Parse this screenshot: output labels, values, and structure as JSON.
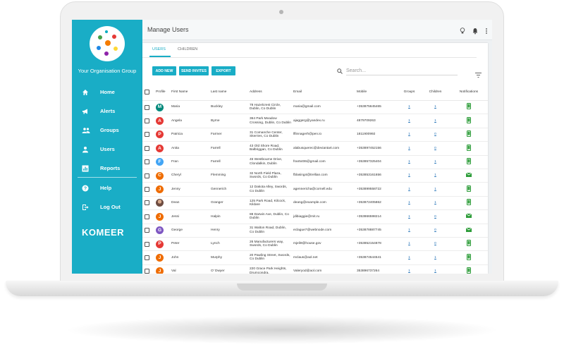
{
  "app": {
    "title": "Manage Users"
  },
  "sidebar": {
    "org_name": "Your Organisation Group",
    "items": [
      {
        "label": "Home",
        "icon": "home-icon"
      },
      {
        "label": "Alerts",
        "icon": "megaphone-icon"
      },
      {
        "label": "Groups",
        "icon": "group-icon"
      },
      {
        "label": "Users",
        "icon": "user-icon"
      },
      {
        "label": "Reports",
        "icon": "chart-icon"
      },
      {
        "label": "Help",
        "icon": "help-icon"
      },
      {
        "label": "Log Out",
        "icon": "logout-icon"
      }
    ],
    "brand": "KOMEER"
  },
  "tabs": [
    {
      "label": "USERS"
    },
    {
      "label": "CHILDREN"
    }
  ],
  "toolbar": {
    "add_new": "ADD NEW",
    "send_invites": "SEND INVITES",
    "export": "EXPORT"
  },
  "search": {
    "placeholder": "Search..."
  },
  "table": {
    "headers": [
      "Profile",
      "First Name",
      "Last name",
      "Address",
      "Email",
      "Mobile",
      "Groups",
      "Children",
      "Notifications"
    ],
    "rows": [
      {
        "initial": "M",
        "color": "#00897b",
        "first": "Maria",
        "last": "Buckley",
        "address": "78 Hazelcrest Circle, Dublin, Co Dublin",
        "email": "maria@gmail.com",
        "mobile": "+353875645465",
        "groups": "1",
        "children": "1",
        "notif": "phone"
      },
      {
        "initial": "A",
        "color": "#e53935",
        "first": "Angela",
        "last": "Byrne",
        "address": "364 Park Meadow Crossing, Dublin, Co Dublin",
        "email": "ajaggerg@yandex.ru",
        "mobile": "4879709263",
        "groups": "1",
        "children": "1",
        "notif": "phone"
      },
      {
        "initial": "P",
        "color": "#e53935",
        "first": "Patricia",
        "last": "Farmer",
        "address": "31 Comanche Center, Skerries, Co Dublin",
        "email": "lflinnagerh@pen.io",
        "mobile": "1811900992",
        "groups": "1",
        "children": "0",
        "notif": "phone"
      },
      {
        "initial": "A",
        "color": "#e53935",
        "first": "Anita",
        "last": "Farrell",
        "address": "43 Old Shore Road, Balbriggan, Co Dublin",
        "email": "alabusquerec@deviantart.com",
        "mobile": "+353897452156",
        "groups": "1",
        "children": "0",
        "notif": "phone"
      },
      {
        "initial": "F",
        "color": "#42a5f5",
        "first": "Fran",
        "last": "Farrell",
        "address": "45 Westbourne Drive, Clondalkin, Dublin",
        "email": "fran5406@gmail.com",
        "mobile": "+353857325404",
        "groups": "1",
        "children": "1",
        "notif": "phone"
      },
      {
        "initial": "C",
        "color": "#ef6c00",
        "first": "Cheryl",
        "last": "Flemming",
        "address": "32 North Field Plaza, Swords, Co Dublin",
        "email": "fblasing4@trellian.com",
        "mobile": "+353853161656",
        "groups": "1",
        "children": "1",
        "notif": "mail"
      },
      {
        "initial": "J",
        "color": "#ef6c00",
        "first": "Jenny",
        "last": "Gennerich",
        "address": "12 Dakota Alley, Swords, Co Dublin",
        "email": "agennericha@cornell.edu",
        "mobile": "+353899558722",
        "groups": "1",
        "children": "1",
        "notif": "phone"
      },
      {
        "initial": "",
        "color": "#8d6e63",
        "photo": true,
        "first": "Dean",
        "last": "Granger",
        "address": "125 Park Road, Kilcock, Kildare",
        "email": "deang@example.com",
        "mobile": "+353872405862",
        "groups": "1",
        "children": "1",
        "notif": "phone"
      },
      {
        "initial": "J",
        "color": "#ef6c00",
        "first": "Jessi",
        "last": "Halpin",
        "address": "88 Darwin Ave, Dublin, Co Dublin",
        "email": "jdibiaggie@mit.ru",
        "mobile": "+353866598214",
        "groups": "1",
        "children": "0",
        "notif": "mail"
      },
      {
        "initial": "G",
        "color": "#7e57c2",
        "first": "George",
        "last": "Henry",
        "address": "31 Walton Road, Dublin, Co Dublin",
        "email": "eclague7@webnode.com",
        "mobile": "+353878887745",
        "groups": "1",
        "children": "0",
        "notif": "mail"
      },
      {
        "initial": "P",
        "color": "#e53935",
        "first": "Peter",
        "last": "Lynch",
        "address": "26 Manufacturers way, Swords, Co Dublin",
        "email": "mjeli9@house.gov",
        "mobile": "+353852154878",
        "groups": "1",
        "children": "0",
        "notif": "phone"
      },
      {
        "initial": "J",
        "color": "#ef6c00",
        "first": "John",
        "last": "Murphy",
        "address": "20 Pawling Street, Swords, Co Dublin",
        "email": "mclaus@aol.net",
        "mobile": "+353874544541",
        "groups": "1",
        "children": "1",
        "notif": "phone"
      },
      {
        "initial": "J",
        "color": "#ef6c00",
        "first": "Val",
        "last": "O' Dwyer",
        "address": "220 Grace Park Heights, Drumcondra,",
        "email": "Valeryod@aol.com",
        "mobile": "353896737264",
        "groups": "1",
        "children": "1",
        "notif": "phone"
      }
    ]
  }
}
